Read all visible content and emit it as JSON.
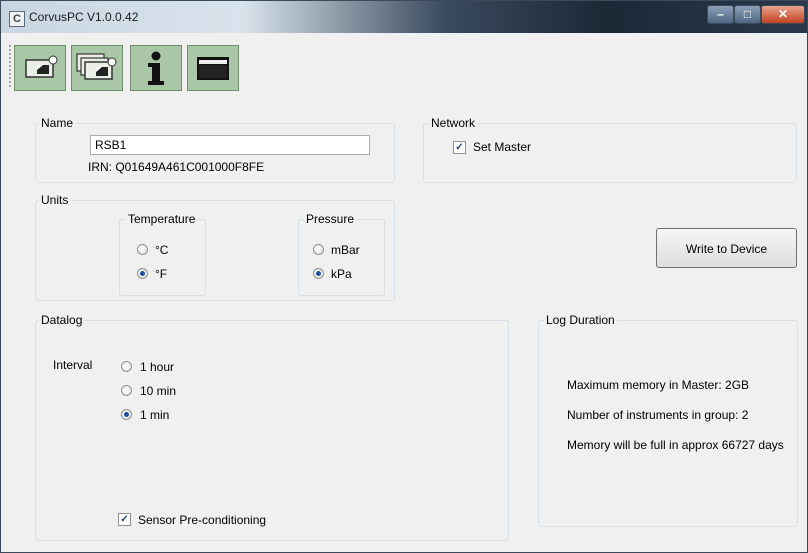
{
  "window": {
    "title": "CorvusPC V1.0.0.42",
    "app_icon_letter": "C"
  },
  "toolbar": {
    "buttons": [
      "single-device-icon",
      "multi-device-icon",
      "info-icon",
      "screen-icon"
    ]
  },
  "name_group": {
    "label": "Name",
    "name_value": "RSB1",
    "irn_text": "IRN: Q01649A461C001000F8FE"
  },
  "network_group": {
    "label": "Network",
    "set_master_label": "Set Master",
    "set_master_checked": true
  },
  "units_group": {
    "label": "Units",
    "temperature": {
      "label": "Temperature",
      "options": [
        "°C",
        "°F"
      ],
      "selected": "°F"
    },
    "pressure": {
      "label": "Pressure",
      "options": [
        "mBar",
        "kPa"
      ],
      "selected": "kPa"
    }
  },
  "write_button_label": "Write to Device",
  "datalog_group": {
    "label": "Datalog",
    "interval_label": "Interval",
    "interval_options": [
      "1 hour",
      "10 min",
      "1 min"
    ],
    "selected_interval": "1 min",
    "sensor_preconditioning_label": "Sensor Pre-conditioning",
    "sensor_preconditioning_checked": true
  },
  "log_duration_group": {
    "label": "Log Duration",
    "max_memory_text": "Maximum memory in Master: 2GB",
    "instrument_count_text": "Number of instruments in group: 2",
    "memory_full_text": "Memory will be full in approx 66727 days"
  }
}
